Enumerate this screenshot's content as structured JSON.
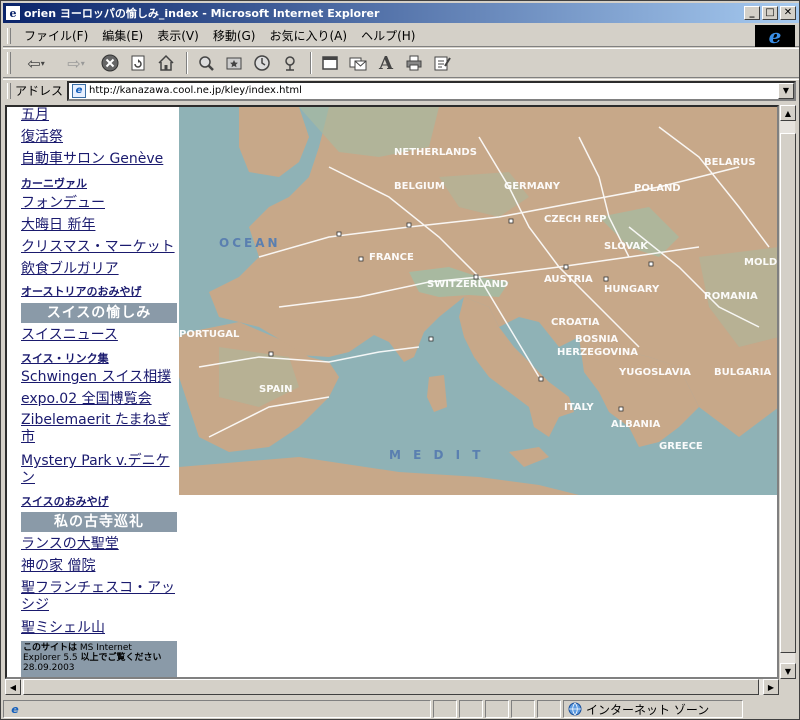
{
  "window": {
    "title": "orien ヨーロッパの愉しみ_index - Microsoft Internet Explorer",
    "app_icon": "ie-page-icon"
  },
  "menubar": {
    "items": [
      "ファイル(F)",
      "編集(E)",
      "表示(V)",
      "移動(G)",
      "お気に入り(A)",
      "ヘルプ(H)"
    ]
  },
  "toolbar": {
    "buttons": [
      "back-icon",
      "forward-icon",
      "stop-icon",
      "refresh-icon",
      "home-icon",
      "search-icon",
      "favorites-icon",
      "history-icon",
      "channels-icon",
      "fullscreen-icon",
      "mail-icon",
      "font-icon",
      "print-icon",
      "edit-icon"
    ]
  },
  "address": {
    "label": "アドレス",
    "url": "http://kanazawa.cool.ne.jp/kley/index.html"
  },
  "sidebar": {
    "links_top": [
      {
        "label": "五月",
        "bold": false
      },
      {
        "label": "復活祭",
        "bold": false
      },
      {
        "label": "自動車サロン Genève",
        "bold": false
      },
      {
        "label": "カーニヴァル",
        "bold": true
      },
      {
        "label": "フォンデュー",
        "bold": false
      },
      {
        "label": "大晦日 新年",
        "bold": false
      },
      {
        "label": "クリスマス・マーケット",
        "bold": false
      },
      {
        "label": "飲食ブルガリア",
        "bold": false
      },
      {
        "label": "オーストリアのおみやげ",
        "bold": true
      }
    ],
    "header_swiss": "スイスの愉しみ",
    "links_swiss": [
      {
        "label": "スイスニュース",
        "bold": false
      },
      {
        "label": "スイス・リンク集",
        "bold": true
      },
      {
        "label": "Schwingen スイス相撲",
        "bold": false
      },
      {
        "label": "expo.02 全国博覧会",
        "bold": false
      },
      {
        "label": "Zibelemaerit たまねぎ市",
        "bold": false
      },
      {
        "label": "Mystery Park  v.デニケン",
        "bold": false
      },
      {
        "label": "スイスのおみやげ",
        "bold": true
      }
    ],
    "header_temples": "私の古寺巡礼",
    "links_temples": [
      {
        "label": "ランスの大聖堂"
      },
      {
        "label": "神の家  僧院"
      },
      {
        "label": "聖フランチェスコ・アッシジ"
      },
      {
        "label": "聖ミシェル山"
      }
    ],
    "notice": {
      "line1_bold": "このサイトは",
      "line1_rest": " MS Internet",
      "line2_rest": "Explorer 5.5 ",
      "line2_bold": "以上でご覧ください",
      "date": "28.09.2003"
    }
  },
  "map": {
    "labels": {
      "netherlands": "NETHERLANDS",
      "belgium": "BELGIUM",
      "germany": "GERMANY",
      "poland": "POLAND",
      "belarus": "BELARUS",
      "czech": "CZECH REP",
      "slovakia": "SLOVAK",
      "france": "FRANCE",
      "switzerland": "SWITZERLAND",
      "austria": "AUSTRIA",
      "hungary": "HUNGARY",
      "romania": "ROMANIA",
      "moldova": "MOLD",
      "croatia": "CROATIA",
      "bosnia": "BOSNIA",
      "herzegovina": "HERZEGOVINA",
      "yugoslavia": "YUGOSLAVIA",
      "bulgaria": "BULGARIA",
      "portugal": "PORTUGAL",
      "spain": "SPAIN",
      "italy": "ITALY",
      "albania": "ALBANIA",
      "greece": "GREECE",
      "ocean": "OCEAN",
      "med": "M E D I T"
    },
    "colors": {
      "sea": "#8fb2b6",
      "land": "#c7a889",
      "highland": "#a8b9a0",
      "roads": "#ffffff"
    }
  },
  "status": {
    "zone": "インターネット ゾーン",
    "left_icon": "ie-page-icon",
    "zone_icon": "internet-globe-icon"
  }
}
